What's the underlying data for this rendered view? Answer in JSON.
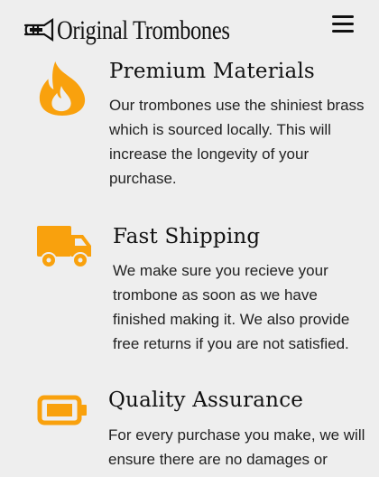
{
  "header": {
    "logo_text": "Original Trombones",
    "logo_icon": "trombone-logo-icon",
    "menu_icon": "hamburger-menu-icon"
  },
  "colors": {
    "accent": "#f9a10d",
    "background": "#eeeeee",
    "text": "#222222"
  },
  "features": [
    {
      "icon": "flame-icon",
      "title": "Premium Materials",
      "description": "Our trombones use the shiniest brass which is sourced locally. This will increase the longevity of your purchase."
    },
    {
      "icon": "truck-icon",
      "title": "Fast Shipping",
      "description": "We make sure you recieve your trombone as soon as we have finished making it. We also provide free returns if you are not satisfied."
    },
    {
      "icon": "battery-icon",
      "title": "Quality Assurance",
      "description": "For every purchase you make, we will ensure there are no damages or"
    }
  ]
}
